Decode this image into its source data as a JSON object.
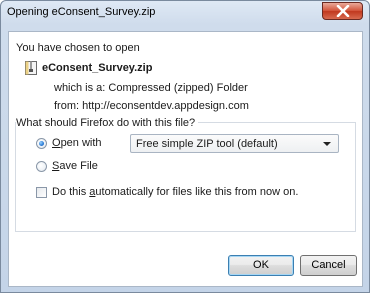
{
  "window": {
    "title": "Opening eConsent_Survey.zip"
  },
  "intro": "You have chosen to open",
  "file": {
    "name": "eConsent_Survey.zip",
    "type_label": "which is a: ",
    "type_value": "Compressed (zipped) Folder",
    "from_label": "from: ",
    "from_value": "http://econsentdev.appdesign.com"
  },
  "question": "What should Firefox do with this file?",
  "options": {
    "open_with_prefix": "",
    "open_with_accel": "O",
    "open_with_rest": "pen with",
    "open_with_app": "Free simple ZIP tool (default)",
    "save_accel": "S",
    "save_rest": "ave File",
    "auto_pre": "Do this ",
    "auto_accel": "a",
    "auto_post": "utomatically for files like this from now on."
  },
  "buttons": {
    "ok": "OK",
    "cancel": "Cancel"
  },
  "icons": {
    "close": "close-icon",
    "file": "zip-file-icon",
    "dropdown": "chevron-down-icon"
  },
  "colors": {
    "close_button": "#c0381f",
    "radio_selected": "#2a7bd6",
    "default_button_border": "#3c7fb1"
  }
}
